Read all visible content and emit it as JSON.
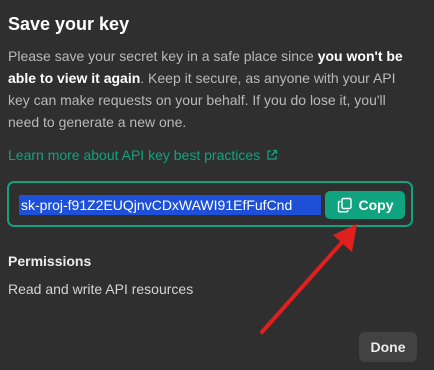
{
  "dialog": {
    "title": "Save your key",
    "description": {
      "part1": "Please save your secret key in a safe place since ",
      "bold1": "you won't be able to view it again",
      "part2": ". Keep it secure, as anyone with your API key can make requests on your behalf. If you do lose it, you'll need to generate a new one."
    },
    "learn_link": "Learn more about API key best practices",
    "key_value": "sk-proj-f91Z2EUQjnvCDxWAWI91EfFufCnd",
    "copy_label": "Copy",
    "permissions_heading": "Permissions",
    "permissions_value": "Read and write API resources",
    "done_label": "Done"
  },
  "icons": {
    "external_link": "external-link-icon",
    "copy": "copy-icon"
  },
  "colors": {
    "background": "#2f2f2f",
    "accent": "#10a37f",
    "selection": "#1d4fd8",
    "annotation_arrow": "#e0201c"
  }
}
